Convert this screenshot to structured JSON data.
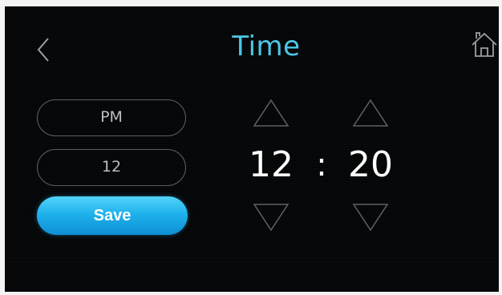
{
  "header": {
    "title": "Time",
    "back_icon": "chevron-left-icon",
    "home_icon": "home-icon"
  },
  "settings": {
    "period": "PM",
    "hour_format": "12",
    "save_label": "Save"
  },
  "clock": {
    "hour": "12",
    "separator": ":",
    "minute": "20"
  },
  "colors": {
    "accent": "#4cc8e8",
    "save_button": "#1fb0ea",
    "background": "#050607"
  }
}
